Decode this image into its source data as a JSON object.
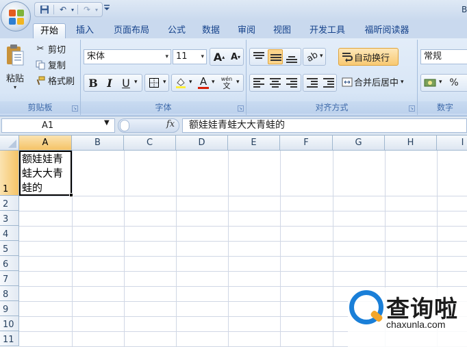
{
  "title_bar": {
    "title": "B"
  },
  "qat": {
    "save_icon": "save-icon",
    "undo_icon": "undo-icon",
    "redo_icon": "redo-icon"
  },
  "tabs": [
    {
      "label": "开始",
      "active": true
    },
    {
      "label": "插入"
    },
    {
      "label": "页面布局"
    },
    {
      "label": "公式"
    },
    {
      "label": "数据"
    },
    {
      "label": "审阅"
    },
    {
      "label": "视图"
    },
    {
      "label": "开发工具"
    },
    {
      "label": "福昕阅读器"
    }
  ],
  "clipboard": {
    "paste_label": "粘贴",
    "cut_label": "剪切",
    "copy_label": "复制",
    "format_painter_label": "格式刷",
    "group_label": "剪贴板"
  },
  "font": {
    "font_name": "宋体",
    "font_size": "11",
    "bold": "B",
    "italic": "I",
    "underline": "U",
    "font_color_letter": "A",
    "group_label": "字体",
    "accent_color": "#d81e06"
  },
  "alignment": {
    "wrap_text_label": "自动换行",
    "merge_center_label": "合并后居中",
    "group_label": "对齐方式"
  },
  "number": {
    "format_value": "常规",
    "percent": "%",
    "group_label": "数字"
  },
  "formula_bar": {
    "name_box": "A1",
    "fx": "fx",
    "formula": "额娃娃青蛙大大青蛙的"
  },
  "grid": {
    "columns": [
      "A",
      "B",
      "C",
      "D",
      "E",
      "F",
      "G",
      "H",
      "I"
    ],
    "rows": [
      "1",
      "2",
      "3",
      "4",
      "5",
      "6",
      "7",
      "8",
      "9",
      "10",
      "11"
    ],
    "selected_cell": "A1",
    "cell_a1": "额娃娃青蛙大大青蛙的"
  },
  "watermark": {
    "cn": "查询啦",
    "en": "chaxunla.com"
  }
}
